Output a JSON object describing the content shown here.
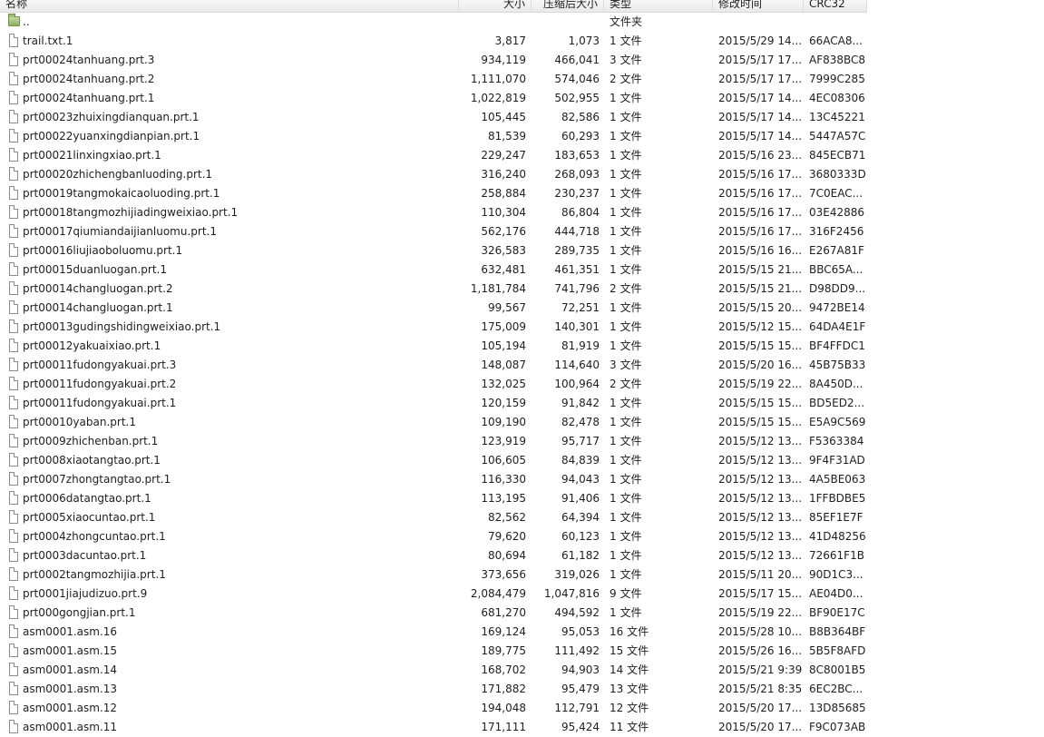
{
  "columns": {
    "name": "名称",
    "size": "大小",
    "packed": "压缩后大小",
    "type": "类型",
    "modified": "修改时间",
    "crc": "CRC32"
  },
  "parent": {
    "name": "..",
    "type": "文件夹"
  },
  "files": [
    {
      "name": "trail.txt.1",
      "size": "3,817",
      "packed": "1,073",
      "type": "1 文件",
      "modified": "2015/5/29 14...",
      "crc": "66ACA8..."
    },
    {
      "name": "prt00024tanhuang.prt.3",
      "size": "934,119",
      "packed": "466,041",
      "type": "3 文件",
      "modified": "2015/5/17 17...",
      "crc": "AF838BC8"
    },
    {
      "name": "prt00024tanhuang.prt.2",
      "size": "1,111,070",
      "packed": "574,046",
      "type": "2 文件",
      "modified": "2015/5/17 17...",
      "crc": "7999C285"
    },
    {
      "name": "prt00024tanhuang.prt.1",
      "size": "1,022,819",
      "packed": "502,955",
      "type": "1 文件",
      "modified": "2015/5/17 14...",
      "crc": "4EC08306"
    },
    {
      "name": "prt00023zhuixingdianquan.prt.1",
      "size": "105,445",
      "packed": "82,586",
      "type": "1 文件",
      "modified": "2015/5/17 14...",
      "crc": "13C45221"
    },
    {
      "name": "prt00022yuanxingdianpian.prt.1",
      "size": "81,539",
      "packed": "60,293",
      "type": "1 文件",
      "modified": "2015/5/17 14...",
      "crc": "5447A57C"
    },
    {
      "name": "prt00021linxingxiao.prt.1",
      "size": "229,247",
      "packed": "183,653",
      "type": "1 文件",
      "modified": "2015/5/16 23...",
      "crc": "845ECB71"
    },
    {
      "name": "prt00020zhichengbanluoding.prt.1",
      "size": "316,240",
      "packed": "268,093",
      "type": "1 文件",
      "modified": "2015/5/16 17...",
      "crc": "3680333D"
    },
    {
      "name": "prt00019tangmokaicaoluoding.prt.1",
      "size": "258,884",
      "packed": "230,237",
      "type": "1 文件",
      "modified": "2015/5/16 17...",
      "crc": "7C0EAC..."
    },
    {
      "name": "prt00018tangmozhijiadingweixiao.prt.1",
      "size": "110,304",
      "packed": "86,804",
      "type": "1 文件",
      "modified": "2015/5/16 17...",
      "crc": "03E42886"
    },
    {
      "name": "prt00017qiumiandaijianluomu.prt.1",
      "size": "562,176",
      "packed": "444,718",
      "type": "1 文件",
      "modified": "2015/5/16 17...",
      "crc": "316F2456"
    },
    {
      "name": "prt00016liujiaoboluomu.prt.1",
      "size": "326,583",
      "packed": "289,735",
      "type": "1 文件",
      "modified": "2015/5/16 16...",
      "crc": "E267A81F"
    },
    {
      "name": "prt00015duanluogan.prt.1",
      "size": "632,481",
      "packed": "461,351",
      "type": "1 文件",
      "modified": "2015/5/15 21...",
      "crc": "BBC65A..."
    },
    {
      "name": "prt00014changluogan.prt.2",
      "size": "1,181,784",
      "packed": "741,796",
      "type": "2 文件",
      "modified": "2015/5/15 21...",
      "crc": "D98DD9..."
    },
    {
      "name": "prt00014changluogan.prt.1",
      "size": "99,567",
      "packed": "72,251",
      "type": "1 文件",
      "modified": "2015/5/15 20...",
      "crc": "9472BE14"
    },
    {
      "name": "prt00013gudingshidingweixiao.prt.1",
      "size": "175,009",
      "packed": "140,301",
      "type": "1 文件",
      "modified": "2015/5/12 15...",
      "crc": "64DA4E1F"
    },
    {
      "name": "prt00012yakuaixiao.prt.1",
      "size": "105,194",
      "packed": "81,919",
      "type": "1 文件",
      "modified": "2015/5/15 15...",
      "crc": "BF4FFDC1"
    },
    {
      "name": "prt00011fudongyakuai.prt.3",
      "size": "148,087",
      "packed": "114,640",
      "type": "3 文件",
      "modified": "2015/5/20 16...",
      "crc": "45B75B33"
    },
    {
      "name": "prt00011fudongyakuai.prt.2",
      "size": "132,025",
      "packed": "100,964",
      "type": "2 文件",
      "modified": "2015/5/19 22...",
      "crc": "8A450D..."
    },
    {
      "name": "prt00011fudongyakuai.prt.1",
      "size": "120,159",
      "packed": "91,842",
      "type": "1 文件",
      "modified": "2015/5/15 15...",
      "crc": "BD5ED2..."
    },
    {
      "name": "prt00010yaban.prt.1",
      "size": "109,190",
      "packed": "82,478",
      "type": "1 文件",
      "modified": "2015/5/15 15...",
      "crc": "E5A9C569"
    },
    {
      "name": "prt0009zhichenban.prt.1",
      "size": "123,919",
      "packed": "95,717",
      "type": "1 文件",
      "modified": "2015/5/12 13...",
      "crc": "F5363384"
    },
    {
      "name": "prt0008xiaotangtao.prt.1",
      "size": "106,605",
      "packed": "84,839",
      "type": "1 文件",
      "modified": "2015/5/12 13...",
      "crc": "9F4F31AD"
    },
    {
      "name": "prt0007zhongtangtao.prt.1",
      "size": "116,330",
      "packed": "94,043",
      "type": "1 文件",
      "modified": "2015/5/12 13...",
      "crc": "4A5BE063"
    },
    {
      "name": "prt0006datangtao.prt.1",
      "size": "113,195",
      "packed": "91,406",
      "type": "1 文件",
      "modified": "2015/5/12 13...",
      "crc": "1FFBDBE5"
    },
    {
      "name": "prt0005xiaocuntao.prt.1",
      "size": "82,562",
      "packed": "64,394",
      "type": "1 文件",
      "modified": "2015/5/12 13...",
      "crc": "85EF1E7F"
    },
    {
      "name": "prt0004zhongcuntao.prt.1",
      "size": "79,620",
      "packed": "60,123",
      "type": "1 文件",
      "modified": "2015/5/12 13...",
      "crc": "41D48256"
    },
    {
      "name": "prt0003dacuntao.prt.1",
      "size": "80,694",
      "packed": "61,182",
      "type": "1 文件",
      "modified": "2015/5/12 13...",
      "crc": "72661F1B"
    },
    {
      "name": "prt0002tangmozhijia.prt.1",
      "size": "373,656",
      "packed": "319,026",
      "type": "1 文件",
      "modified": "2015/5/11 20...",
      "crc": "90D1C3..."
    },
    {
      "name": "prt0001jiajudizuo.prt.9",
      "size": "2,084,479",
      "packed": "1,047,816",
      "type": "9 文件",
      "modified": "2015/5/17 15...",
      "crc": "AE04D0..."
    },
    {
      "name": "prt000gongjian.prt.1",
      "size": "681,270",
      "packed": "494,592",
      "type": "1 文件",
      "modified": "2015/5/19 22...",
      "crc": "BF90E17C"
    },
    {
      "name": "asm0001.asm.16",
      "size": "169,124",
      "packed": "95,053",
      "type": "16 文件",
      "modified": "2015/5/28 10...",
      "crc": "B8B364BF"
    },
    {
      "name": "asm0001.asm.15",
      "size": "189,775",
      "packed": "111,492",
      "type": "15 文件",
      "modified": "2015/5/26 16...",
      "crc": "5B5F8AFD"
    },
    {
      "name": "asm0001.asm.14",
      "size": "168,702",
      "packed": "94,903",
      "type": "14 文件",
      "modified": "2015/5/21 9:39",
      "crc": "8C8001B5"
    },
    {
      "name": "asm0001.asm.13",
      "size": "171,882",
      "packed": "95,479",
      "type": "13 文件",
      "modified": "2015/5/21 8:35",
      "crc": "6EC2BC..."
    },
    {
      "name": "asm0001.asm.12",
      "size": "194,048",
      "packed": "112,791",
      "type": "12 文件",
      "modified": "2015/5/20 17...",
      "crc": "13D85685"
    },
    {
      "name": "asm0001.asm.11",
      "size": "171,111",
      "packed": "95,424",
      "type": "11 文件",
      "modified": "2015/5/20 17...",
      "crc": "F9C073AB"
    }
  ]
}
